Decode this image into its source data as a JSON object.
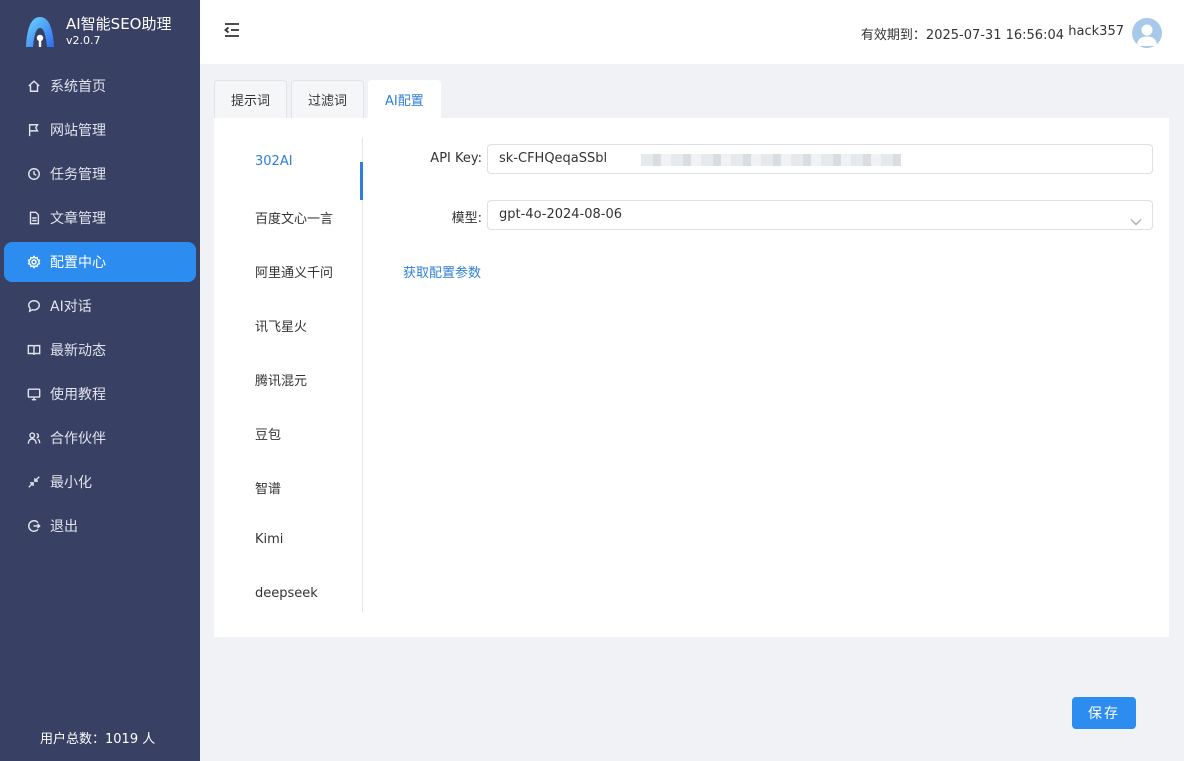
{
  "app": {
    "name": "AI智能SEO助理",
    "version": "v2.0.7"
  },
  "sidebar": {
    "items": [
      {
        "label": "系统首页",
        "icon": "home-icon"
      },
      {
        "label": "网站管理",
        "icon": "flag-icon"
      },
      {
        "label": "任务管理",
        "icon": "clock-icon"
      },
      {
        "label": "文章管理",
        "icon": "document-icon"
      },
      {
        "label": "配置中心",
        "icon": "gear-icon"
      },
      {
        "label": "AI对话",
        "icon": "chat-icon"
      },
      {
        "label": "最新动态",
        "icon": "book-icon"
      },
      {
        "label": "使用教程",
        "icon": "monitor-icon"
      },
      {
        "label": "合作伙伴",
        "icon": "partner-icon"
      },
      {
        "label": "最小化",
        "icon": "minimize-icon"
      },
      {
        "label": "退出",
        "icon": "logout-icon"
      }
    ],
    "active_index": 4,
    "user_count": "用户总数：1019 人"
  },
  "header": {
    "expiry": "有效期到：2025-07-31 16:56:04",
    "username": "hack357"
  },
  "tabs": [
    {
      "label": "提示词"
    },
    {
      "label": "过滤词"
    },
    {
      "label": "AI配置"
    }
  ],
  "active_tab": 2,
  "providers": [
    {
      "label": "302AI"
    },
    {
      "label": "百度文心一言"
    },
    {
      "label": "阿里通义千问"
    },
    {
      "label": "讯飞星火"
    },
    {
      "label": "腾讯混元"
    },
    {
      "label": "豆包"
    },
    {
      "label": "智谱"
    },
    {
      "label": "Kimi"
    },
    {
      "label": "deepseek"
    }
  ],
  "active_provider": 0,
  "form": {
    "api_key_label": "API Key:",
    "api_key_value": "sk-CFHQeqaSSbl",
    "model_label": "模型:",
    "model_value": "gpt-4o-2024-08-06",
    "get_params_link": "获取配置参数"
  },
  "save_label": "保存",
  "colors": {
    "sidebar": "#384063",
    "accent": "#2d8cf0",
    "link": "#2d7fd8"
  }
}
